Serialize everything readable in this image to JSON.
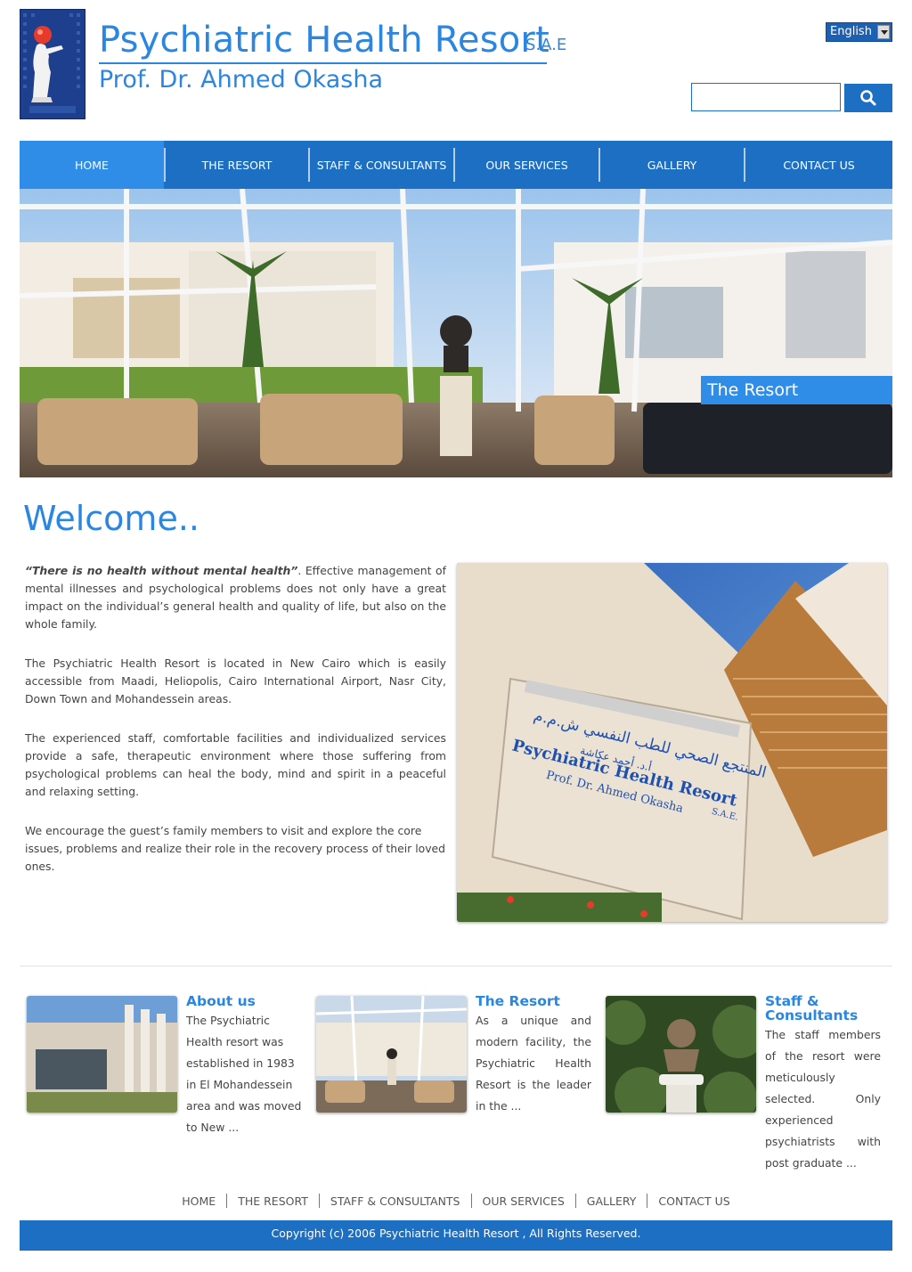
{
  "header": {
    "title": "Psychiatric Health Resort",
    "sae": "S.A.E",
    "subtitle": "Prof. Dr. Ahmed Okasha",
    "language_selected": "English",
    "search_placeholder": "",
    "brand_color": "#1d6fc4",
    "accent_color": "#2f8de8"
  },
  "nav": {
    "items": [
      "HOME",
      "THE RESORT",
      "STAFF & CONSULTANTS",
      "OUR SERVICES",
      "GALLERY",
      "CONTACT US"
    ],
    "active": "HOME"
  },
  "hero": {
    "caption": "The Resort"
  },
  "welcome": {
    "title": "Welcome..",
    "quote": "“There is no health without mental health”",
    "p1_rest": ". Effective management of mental illnesses and psychological problems does not only have a great impact on the individual’s general health and quality of life, but also on the whole family.",
    "p2": "The Psychiatric Health Resort is located in New Cairo which is easily accessible from Maadi, Heliopolis, Cairo International Airport, Nasr City, Down Town and Mohandessein areas.",
    "p3": "The experienced staff, comfortable facilities and individualized services provide a safe, therapeutic environment where those suffering from psychological problems can heal the body, mind and spirit in a peaceful and relaxing setting.",
    "p4": "We encourage the guest’s family members to visit and explore the core issues, problems and realize their role in the recovery process of their loved ones.",
    "sign_arabic": "المنتجع الصحي للطب النفسي ش.م.م",
    "sign_arabic2": "أ.د. أحمد عكاشة",
    "sign_title": "Psychiatric Health Resort",
    "sign_sae": "S.A.E.",
    "sign_subtitle": "Prof. Dr. Ahmed Okasha"
  },
  "features": [
    {
      "title": "About us",
      "text": "The Psychiatric Health resort was established in 1983 in El Mohandessein area and was moved to New ..."
    },
    {
      "title": "The Resort",
      "text": "As a unique and modern facility, the Psychiatric Health Resort is the leader in the ..."
    },
    {
      "title": "Staff & Consultants",
      "text": "The staff members of the resort were meticulously selected. Only experienced psychiatrists with post graduate ..."
    }
  ],
  "footer": {
    "links": [
      "HOME",
      "THE RESORT",
      "STAFF & CONSULTANTS",
      "OUR SERVICES",
      "GALLERY",
      "CONTACT US"
    ],
    "copyright": "Copyright (c) 2006 Psychiatric Health Resort , All Rights Reserved."
  }
}
